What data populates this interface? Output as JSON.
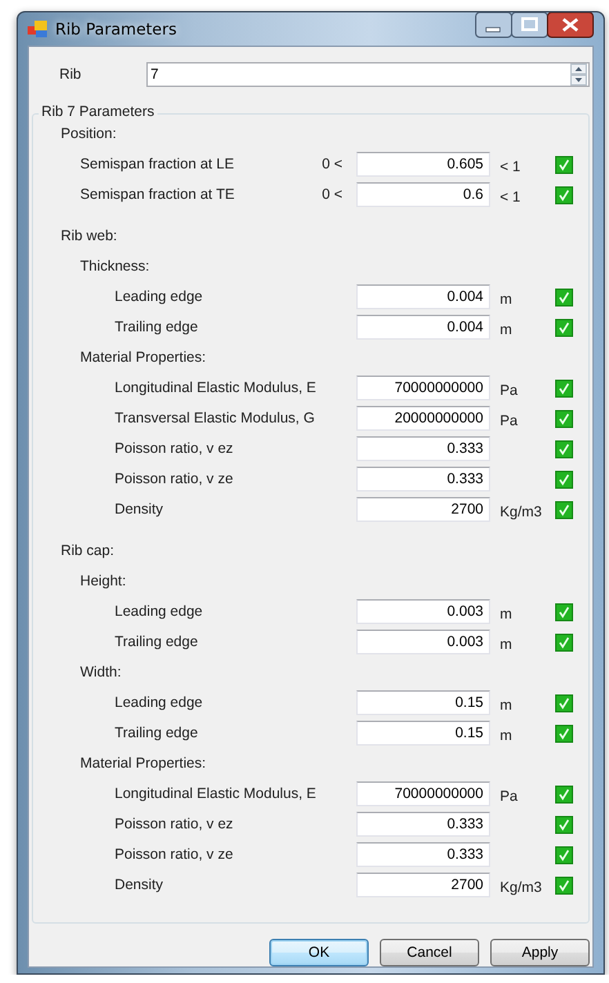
{
  "window": {
    "title": "Rib Parameters"
  },
  "rib_selector": {
    "label": "Rib",
    "value": "7"
  },
  "group": {
    "title": "Rib 7 Parameters",
    "items": [
      {
        "kind": "heading",
        "label": "Position:",
        "children": [
          {
            "kind": "field",
            "label": "Semispan fraction at LE",
            "prefix": "0 <",
            "value": "0.605",
            "unit": "< 1",
            "valid": true
          },
          {
            "kind": "field",
            "label": "Semispan fraction at TE",
            "prefix": "0 <",
            "value": "0.6",
            "unit": "< 1",
            "valid": true
          }
        ]
      },
      {
        "kind": "heading",
        "label": "Rib web:",
        "children": [
          {
            "kind": "heading",
            "label": "Thickness:",
            "children": [
              {
                "kind": "field",
                "label": "Leading edge",
                "value": "0.004",
                "unit": "m",
                "valid": true
              },
              {
                "kind": "field",
                "label": "Trailing edge",
                "value": "0.004",
                "unit": "m",
                "valid": true
              }
            ]
          },
          {
            "kind": "heading",
            "label": "Material Properties:",
            "children": [
              {
                "kind": "field",
                "label": "Longitudinal Elastic Modulus, E",
                "value": "70000000000",
                "unit": "Pa",
                "valid": true
              },
              {
                "kind": "field",
                "label": "Transversal Elastic Modulus, G",
                "value": "20000000000",
                "unit": "Pa",
                "valid": true
              },
              {
                "kind": "field",
                "label": "Poisson ratio, v ez",
                "value": "0.333",
                "valid": true
              },
              {
                "kind": "field",
                "label": "Poisson ratio, v ze",
                "value": "0.333",
                "valid": true
              },
              {
                "kind": "field",
                "label": "Density",
                "value": "2700",
                "unit": "Kg/m3",
                "valid": true
              }
            ]
          }
        ]
      },
      {
        "kind": "heading",
        "label": "Rib cap:",
        "children": [
          {
            "kind": "heading",
            "label": "Height:",
            "children": [
              {
                "kind": "field",
                "label": "Leading edge",
                "value": "0.003",
                "unit": "m",
                "valid": true
              },
              {
                "kind": "field",
                "label": "Trailing edge",
                "value": "0.003",
                "unit": "m",
                "valid": true
              }
            ]
          },
          {
            "kind": "heading",
            "label": "Width:",
            "children": [
              {
                "kind": "field",
                "label": "Leading edge",
                "value": "0.15",
                "unit": "m",
                "valid": true
              },
              {
                "kind": "field",
                "label": "Trailing edge",
                "value": "0.15",
                "unit": "m",
                "valid": true
              }
            ]
          },
          {
            "kind": "heading",
            "label": "Material Properties:",
            "children": [
              {
                "kind": "field",
                "label": "Longitudinal Elastic Modulus, E",
                "value": "70000000000",
                "unit": "Pa",
                "valid": true
              },
              {
                "kind": "field",
                "label": "Poisson ratio, v ez",
                "value": "0.333",
                "valid": true
              },
              {
                "kind": "field",
                "label": "Poisson ratio, v ze",
                "value": "0.333",
                "valid": true
              },
              {
                "kind": "field",
                "label": "Density",
                "value": "2700",
                "unit": "Kg/m3",
                "valid": true
              }
            ]
          }
        ]
      }
    ]
  },
  "buttons": [
    {
      "label": "OK",
      "default": true
    },
    {
      "label": "Cancel",
      "default": false
    },
    {
      "label": "Apply",
      "default": false
    }
  ]
}
